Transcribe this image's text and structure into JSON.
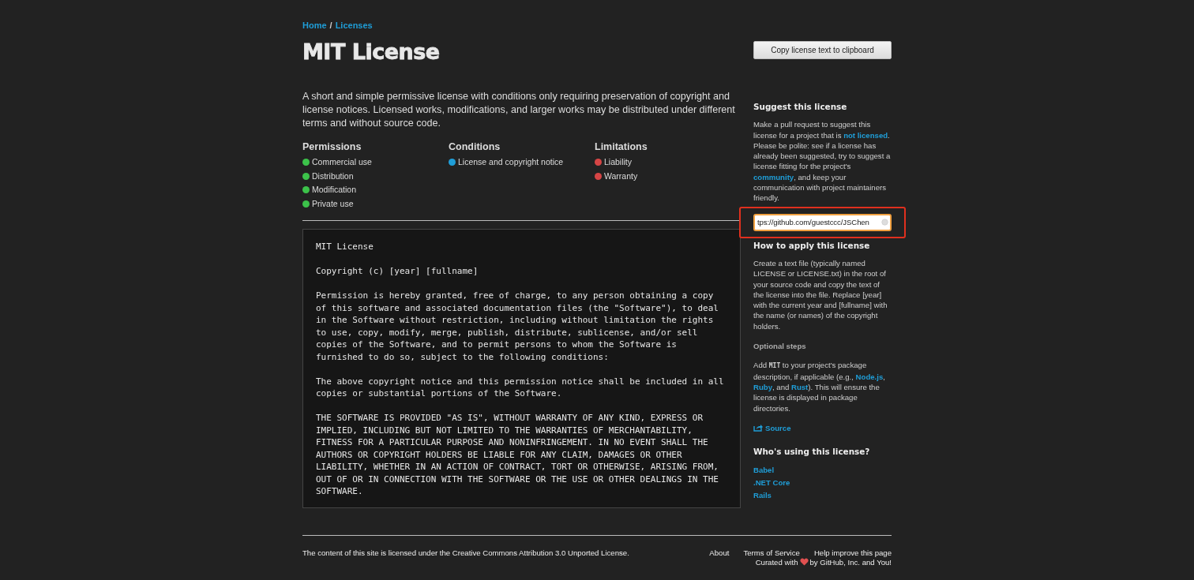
{
  "breadcrumb": [
    {
      "label": "Home"
    },
    {
      "label": "Licenses"
    }
  ],
  "breadcrumb_separator": "/",
  "title": "MIT License",
  "copy_button": "Copy license text to clipboard",
  "description": "A short and simple permissive license with conditions only requiring preservation of copyright and license notices. Licensed works, modifications, and larger works may be distributed under different terms and without source code.",
  "rules": [
    {
      "heading": "Permissions",
      "items": [
        {
          "label": "Commercial use",
          "color": "#3cc24a"
        },
        {
          "label": "Distribution",
          "color": "#3cc24a"
        },
        {
          "label": "Modification",
          "color": "#3cc24a"
        },
        {
          "label": "Private use",
          "color": "#3cc24a"
        }
      ]
    },
    {
      "heading": "Conditions",
      "items": [
        {
          "label": "License and copyright notice",
          "color": "#1f9ed8"
        }
      ]
    },
    {
      "heading": "Limitations",
      "items": [
        {
          "label": "Liability",
          "color": "#d64545"
        },
        {
          "label": "Warranty",
          "color": "#d64545"
        }
      ]
    }
  ],
  "license_text": [
    "MIT License",
    "Copyright (c) [year] [fullname]",
    "Permission is hereby granted, free of charge, to any person obtaining a copy\nof this software and associated documentation files (the \"Software\"), to deal\nin the Software without restriction, including without limitation the rights\nto use, copy, modify, merge, publish, distribute, sublicense, and/or sell\ncopies of the Software, and to permit persons to whom the Software is\nfurnished to do so, subject to the following conditions:",
    "The above copyright notice and this permission notice shall be included in all\ncopies or substantial portions of the Software.",
    "THE SOFTWARE IS PROVIDED \"AS IS\", WITHOUT WARRANTY OF ANY KIND, EXPRESS OR\nIMPLIED, INCLUDING BUT NOT LIMITED TO THE WARRANTIES OF MERCHANTABILITY,\nFITNESS FOR A PARTICULAR PURPOSE AND NONINFRINGEMENT. IN NO EVENT SHALL THE\nAUTHORS OR COPYRIGHT HOLDERS BE LIABLE FOR ANY CLAIM, DAMAGES OR OTHER\nLIABILITY, WHETHER IN AN ACTION OF CONTRACT, TORT OR OTHERWISE, ARISING FROM,\nOUT OF OR IN CONNECTION WITH THE SOFTWARE OR THE USE OR OTHER DEALINGS IN THE\nSOFTWARE."
  ],
  "suggest": {
    "heading": "Suggest this license",
    "parts": [
      {
        "kind": "text",
        "text": "Make a pull request to suggest this license for a project that is "
      },
      {
        "kind": "link",
        "text": "not licensed"
      },
      {
        "kind": "text",
        "text": ". Please be polite: see if a license has already been suggested, try to suggest a license fitting for the project's "
      },
      {
        "kind": "link",
        "text": "community"
      },
      {
        "kind": "text",
        "text": ", and keep your communication with project maintainers friendly."
      }
    ],
    "input_value": "tps://github.com/guestccc/JSChen"
  },
  "apply": {
    "heading": "How to apply this license",
    "text": "Create a text file (typically named LICENSE or LICENSE.txt) in the root of your source code and copy the text of the license into the file. Replace [year] with the current year and [fullname] with the name (or names) of the copyright holders."
  },
  "optional": {
    "heading": "Optional steps",
    "parts": [
      {
        "kind": "text",
        "text": "Add "
      },
      {
        "kind": "code",
        "text": "MIT"
      },
      {
        "kind": "text",
        "text": " to your project's package description, if applicable (e.g., "
      },
      {
        "kind": "link",
        "text": "Node.js"
      },
      {
        "kind": "text",
        "text": ", "
      },
      {
        "kind": "link",
        "text": "Ruby"
      },
      {
        "kind": "text",
        "text": ", and "
      },
      {
        "kind": "link",
        "text": "Rust"
      },
      {
        "kind": "text",
        "text": "). This will ensure the license is displayed in package directories."
      }
    ],
    "source_link": "Source"
  },
  "users": {
    "heading": "Who's using this license?",
    "items": [
      "Babel",
      ".NET Core",
      "Rails"
    ]
  },
  "footer": {
    "text": "The content of this site is licensed under the Creative Commons Attribution 3.0 Unported License.",
    "links": [
      "About",
      "Terms of Service",
      "Help improve this page"
    ],
    "curated_before": "Curated with",
    "curated_after": "by GitHub, Inc. and You!"
  }
}
